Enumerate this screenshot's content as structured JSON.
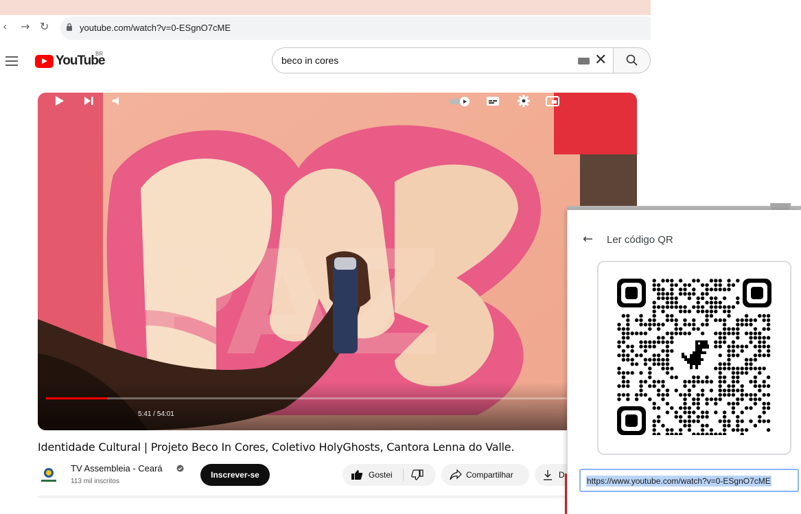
{
  "browser": {
    "url": "youtube.com/watch?v=0-ESgnO7cME"
  },
  "header": {
    "logo_text": "YouTube",
    "country_code": "BR",
    "search_value": "beco in cores"
  },
  "player": {
    "time": "5:41 / 54:01",
    "progress_fraction": 0.105,
    "overlay_text": "PAZ"
  },
  "video": {
    "title": "Identidade Cultural | Projeto Beco In Cores, Coletivo HolyGhosts, Cantora Lenna do Valle.",
    "channel_name": "TV Assembleia - Ceará",
    "subscribers": "113 mil inscritos",
    "subscribe_label": "Inscrever-se",
    "like_label": "Gostei",
    "share_label": "Compartilhar",
    "download_label_partial": "D"
  },
  "qr_panel": {
    "heading": "Ler código QR",
    "url_value": "https://www.youtube.com/watch?v=0-ESgnO7cME"
  },
  "colors": {
    "brand_red": "#ff0000",
    "selection_blue": "#b9d4f7",
    "field_border": "#8ab4f8"
  }
}
